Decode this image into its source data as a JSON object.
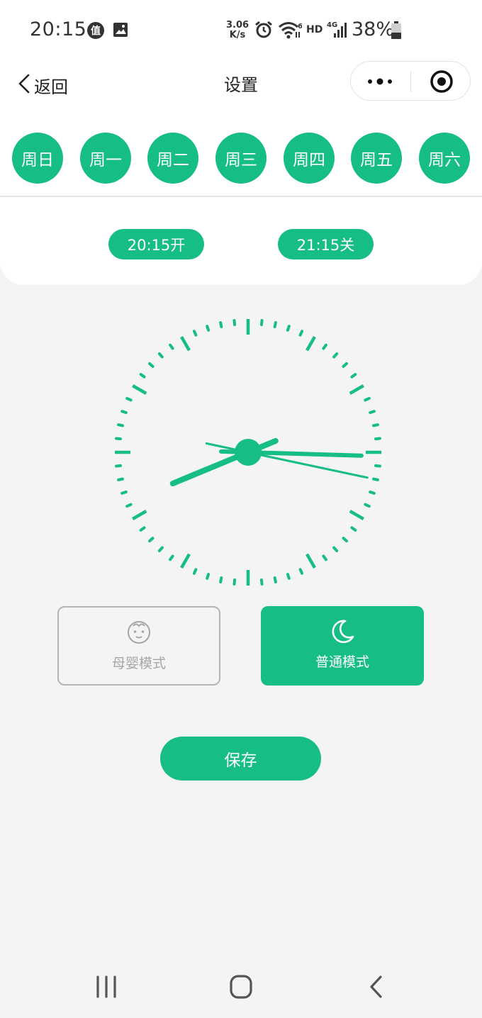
{
  "status_bar": {
    "time": "20:15",
    "app_icon": "zhide-app-icon",
    "image_icon": "gallery-icon",
    "net_speed_value": "3.06",
    "net_speed_unit": "K/s",
    "alarm_icon": "alarm-icon",
    "wifi_icon": "wifi-6-icon",
    "hd_label": "HD",
    "signal_label": "4G",
    "battery_percent": "38%"
  },
  "nav": {
    "back_label": "返回",
    "title": "设置",
    "more_icon": "more-dots-icon",
    "close_icon": "target-close-icon"
  },
  "days": [
    {
      "label": "周日",
      "selected": true
    },
    {
      "label": "周一",
      "selected": true
    },
    {
      "label": "周二",
      "selected": true
    },
    {
      "label": "周三",
      "selected": true
    },
    {
      "label": "周四",
      "selected": true
    },
    {
      "label": "周五",
      "selected": true
    },
    {
      "label": "周六",
      "selected": true
    }
  ],
  "schedule": {
    "on_time": "20:15开",
    "off_time": "21:15关"
  },
  "clock": {
    "hours": 8,
    "minutes": 15,
    "seconds": 17
  },
  "modes": [
    {
      "label": "母婴模式",
      "icon": "baby-face-icon",
      "selected": false
    },
    {
      "label": "普通模式",
      "icon": "moon-icon",
      "selected": true
    }
  ],
  "save_label": "保存",
  "colors": {
    "accent": "#17bd86",
    "background": "#f4f4f4",
    "inactive": "#a6a6a6"
  },
  "system_nav": {
    "recents_icon": "recents-icon",
    "home_icon": "home-icon",
    "back_icon": "back-chevron-icon"
  }
}
